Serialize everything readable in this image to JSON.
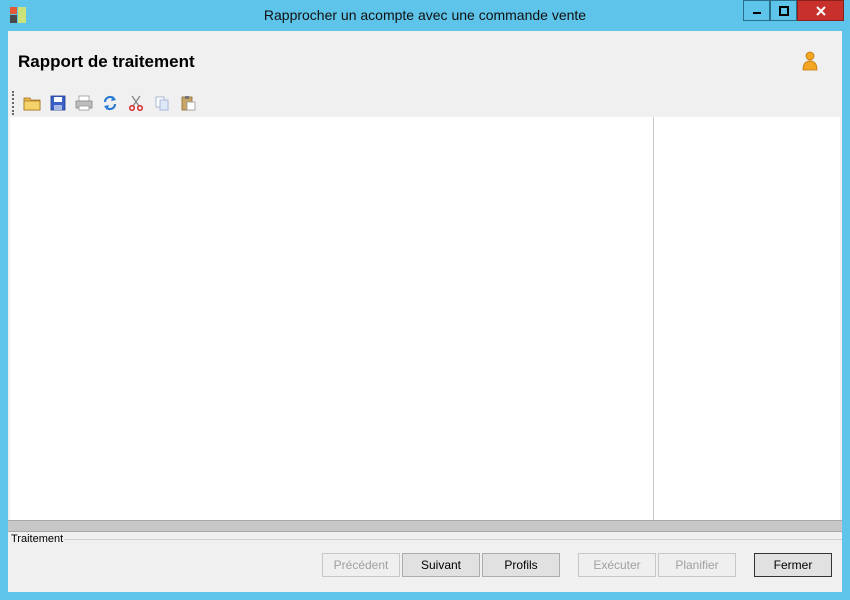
{
  "window": {
    "title": "Rapprocher un acompte avec une commande vente"
  },
  "header": {
    "title": "Rapport de traitement"
  },
  "toolbar": {
    "icons": [
      "open-folder-icon",
      "save-icon",
      "print-icon",
      "refresh-icon",
      "cut-icon",
      "copy-icon",
      "paste-icon"
    ]
  },
  "section": {
    "label": "Traitement"
  },
  "buttons": {
    "precedent": "Précédent",
    "suivant": "Suivant",
    "profils": "Profils",
    "executer": "Exécuter",
    "planifier": "Planifier",
    "fermer": "Fermer"
  },
  "colors": {
    "frame": "#5ec4ea",
    "close": "#c7302b",
    "surface": "#f0f0f0"
  }
}
